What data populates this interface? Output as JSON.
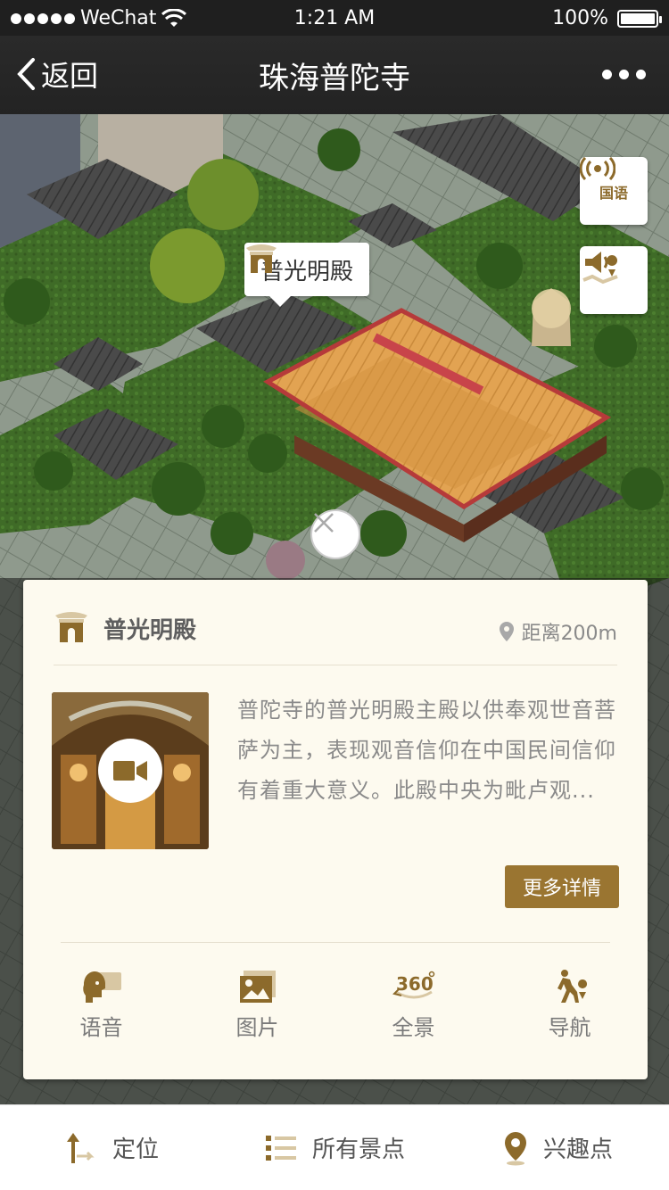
{
  "status_bar": {
    "carrier": "WeChat",
    "time": "1:21 AM",
    "battery_percent": "100%",
    "battery_level": 1.0
  },
  "nav": {
    "back_label": "返回",
    "title": "珠海普陀寺",
    "more_icon": "more-dots-icon"
  },
  "map": {
    "bubble_label": "普光明殿",
    "lang_button_label": "国语",
    "audio_guide_icon": "speaker-map-icon",
    "close_icon": "close-icon"
  },
  "card": {
    "title": "普光明殿",
    "distance": "距离200m",
    "description": "普陀寺的普光明殿主殿以供奉观世音菩萨为主，表现观音信仰在中国民间信仰有着重大意义。此殿中央为毗卢观...",
    "more_button": "更多详情",
    "actions": [
      {
        "label": "语音",
        "icon": "voice-head-icon"
      },
      {
        "label": "图片",
        "icon": "image-icon"
      },
      {
        "label": "全景",
        "icon": "panorama-360-icon"
      },
      {
        "label": "导航",
        "icon": "walk-navigation-icon"
      }
    ]
  },
  "tabbar": {
    "items": [
      {
        "label": "定位",
        "icon": "locate-icon"
      },
      {
        "label": "所有景点",
        "icon": "list-icon"
      },
      {
        "label": "兴趣点",
        "icon": "pin-icon"
      }
    ]
  },
  "colors": {
    "accent": "#9a7531",
    "icon_gold": "#8c6a2b",
    "card_bg": "#fdfaef",
    "nav_bg": "#262626"
  }
}
